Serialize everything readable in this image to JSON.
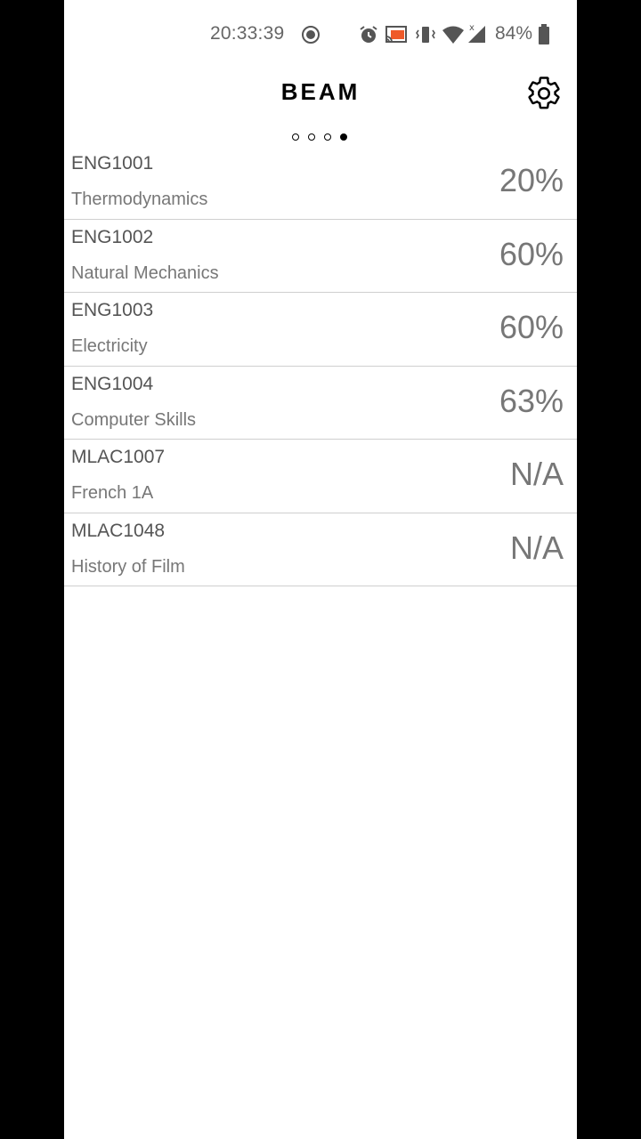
{
  "status_bar": {
    "time": "20:33:39",
    "battery": "84%",
    "icons": [
      "record-icon",
      "alarm-icon",
      "cast-icon",
      "vibrate-icon",
      "wifi-icon",
      "signal-icon",
      "battery-icon"
    ],
    "cast_color": "#ef5a2a"
  },
  "header": {
    "title": "BEAM",
    "settings_icon": "gear-icon"
  },
  "pager": {
    "pages": 4,
    "active_index": 3
  },
  "courses": [
    {
      "code": "ENG1001",
      "name": "Thermodynamics",
      "grade": "20%"
    },
    {
      "code": "ENG1002",
      "name": "Natural Mechanics",
      "grade": "60%"
    },
    {
      "code": "ENG1003",
      "name": "Electricity",
      "grade": "60%"
    },
    {
      "code": "ENG1004",
      "name": "Computer Skills",
      "grade": "63%"
    },
    {
      "code": "MLAC1007",
      "name": "French 1A",
      "grade": "N/A"
    },
    {
      "code": "MLAC1048",
      "name": "History of Film",
      "grade": "N/A"
    }
  ]
}
